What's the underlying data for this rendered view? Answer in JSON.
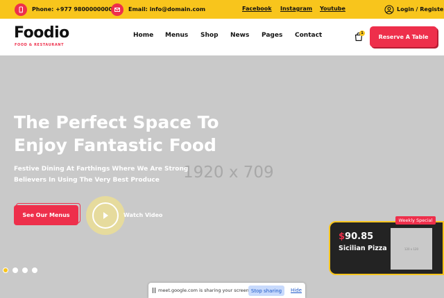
{
  "topbar": {
    "phone_label": "Phone:",
    "phone_value": "+977 9800000000",
    "email_label": "Email:",
    "email_value": "info@domain.com",
    "social_links": [
      "Facebook",
      "Instagram",
      "Youtube"
    ],
    "login_label": "Login / Register",
    "icons": {
      "phone": "phone-icon",
      "email": "mail-icon",
      "user": "user-icon"
    }
  },
  "header": {
    "logo": {
      "word": "Foodio",
      "tagline": "FOOD & RESTAURANT"
    },
    "nav": [
      "Home",
      "Menus",
      "Shop",
      "News",
      "Pages",
      "Contact"
    ],
    "cart_count": "1",
    "reserve_label": "Reserve A Table"
  },
  "hero": {
    "placeholder": "1920 x 709",
    "title_line1": "The Perfect Space To",
    "title_line2": "Enjoy Fantastic Food",
    "subtitle": "Festive Dining At Farthings Where We Are Strong Believers In Using The Very Best Produce",
    "menus_button": "See Our Menus",
    "watch_label": "Watch Video",
    "slider": {
      "count": 4,
      "active_index": 0
    }
  },
  "special": {
    "badge": "Weekly Special",
    "currency": "$",
    "price": "90.85",
    "name": "Sicilian Pizza",
    "image_placeholder": "120 x 120"
  },
  "share_bar": {
    "message": "meet.google.com is sharing your screen.",
    "stop_label": "Stop sharing",
    "hide_label": "Hide"
  },
  "colors": {
    "accent_yellow": "#f8c51c",
    "accent_red": "#ee2f4b",
    "dark": "#232323",
    "hero_bg": "#c9c9c9"
  }
}
